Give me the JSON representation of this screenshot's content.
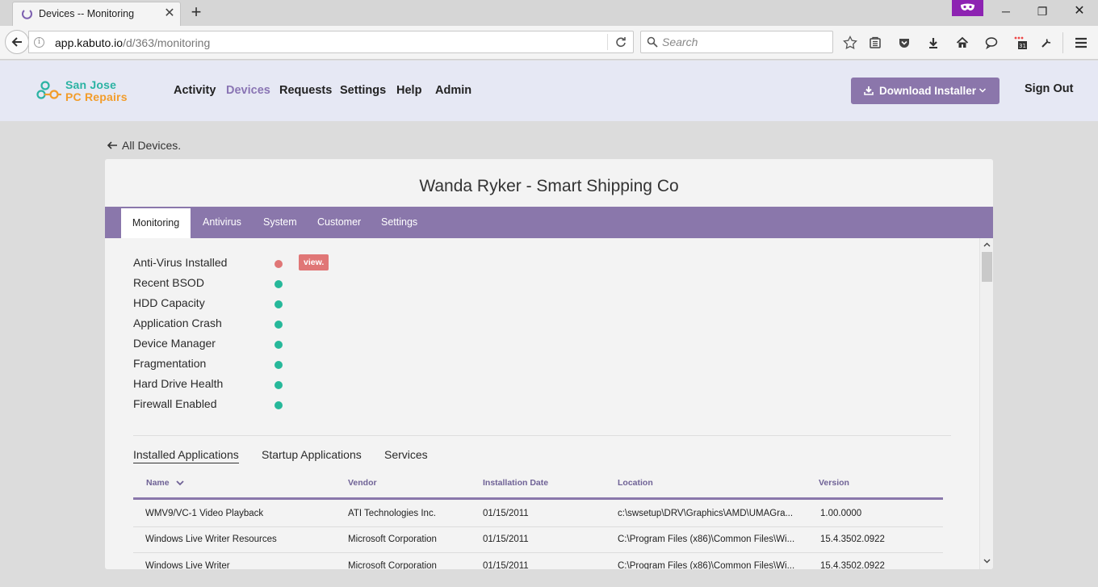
{
  "browser": {
    "tab_title": "Devices -- Monitoring",
    "url_domain": "app.kabuto.io",
    "url_path": "/d/363/monitoring",
    "search_placeholder": "Search"
  },
  "header": {
    "logo_line1": "San Jose",
    "logo_line2": "PC Repairs",
    "nav": [
      "Activity",
      "Devices",
      "Requests",
      "Settings",
      "Help",
      "Admin"
    ],
    "active_nav": "Devices",
    "download_label": "Download Installer",
    "signout_label": "Sign Out"
  },
  "page": {
    "back_label": "All Devices.",
    "device_title": "Wanda Ryker - Smart Shipping Co",
    "tabs": [
      "Monitoring",
      "Antivirus",
      "System",
      "Customer",
      "Settings"
    ],
    "active_tab": "Monitoring"
  },
  "monitoring": {
    "view_label": "view.",
    "items": [
      {
        "label": "Anti-Virus Installed",
        "status": "alert"
      },
      {
        "label": "Recent BSOD",
        "status": "ok"
      },
      {
        "label": "HDD Capacity",
        "status": "ok"
      },
      {
        "label": "Application Crash",
        "status": "ok"
      },
      {
        "label": "Device Manager",
        "status": "ok"
      },
      {
        "label": "Fragmentation",
        "status": "ok"
      },
      {
        "label": "Hard Drive Health",
        "status": "ok"
      },
      {
        "label": "Firewall Enabled",
        "status": "ok"
      }
    ],
    "colors": {
      "ok": "#26b89a",
      "alert": "#e07676"
    }
  },
  "applications": {
    "tabs": [
      "Installed Applications",
      "Startup Applications",
      "Services"
    ],
    "active_tab": "Installed Applications",
    "columns": [
      "Name",
      "Vendor",
      "Installation Date",
      "Location",
      "Version"
    ],
    "rows": [
      [
        "WMV9/VC-1 Video Playback",
        "ATI Technologies Inc.",
        "01/15/2011",
        "c:\\swsetup\\DRV\\Graphics\\AMD\\UMAGra...",
        "1.00.0000"
      ],
      [
        "Windows Live Writer Resources",
        "Microsoft Corporation",
        "01/15/2011",
        "C:\\Program Files (x86)\\Common Files\\Wi...",
        "15.4.3502.0922"
      ],
      [
        "Windows Live Writer",
        "Microsoft Corporation",
        "01/15/2011",
        "C:\\Program Files (x86)\\Common Files\\Wi...",
        "15.4.3502.0922"
      ]
    ]
  },
  "theme": {
    "accent": "#8a77ab",
    "header_bg": "#e6e8f4"
  }
}
